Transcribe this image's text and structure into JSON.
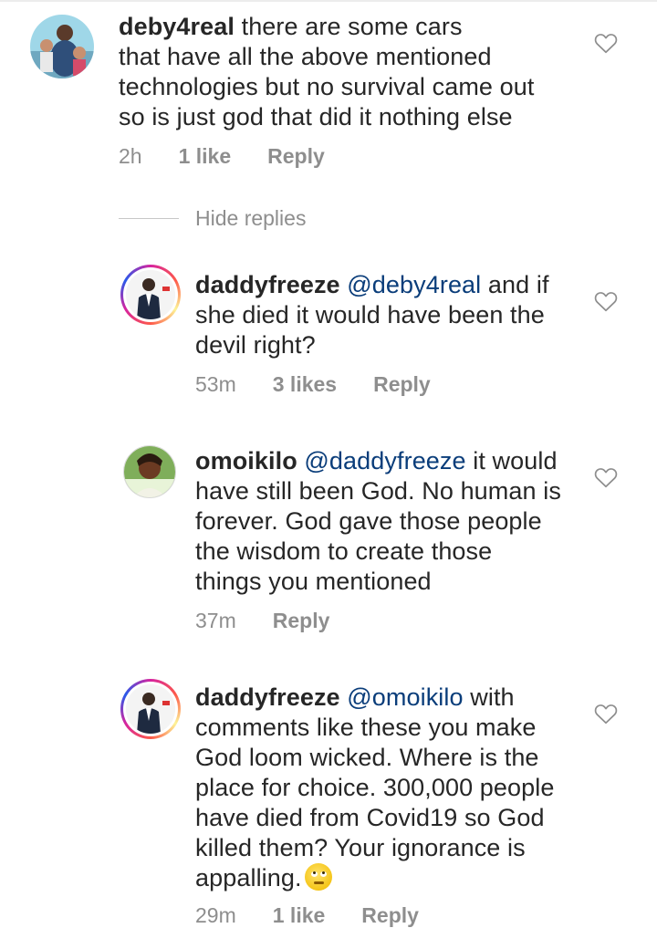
{
  "comments": [
    {
      "username": "deby4real",
      "mention": "",
      "lines": [
        "there are some cars",
        "that have all the above mentioned",
        "technologies but no survival came out",
        "so is just god that did it nothing else"
      ],
      "time": "2h",
      "likes": "1 like",
      "reply": "Reply"
    },
    {
      "username": "daddyfreeze",
      "mention": "@deby4real",
      "lines": [
        "and if",
        "she died it would have been the",
        "devil right?"
      ],
      "time": "53m",
      "likes": "3 likes",
      "reply": "Reply"
    },
    {
      "username": "omoikilo",
      "mention": "@daddyfreeze",
      "lines": [
        "it would",
        "have still been God. No human is",
        "forever. God gave those people",
        "the wisdom to create those",
        "things you mentioned"
      ],
      "time": "37m",
      "likes": "",
      "reply": "Reply"
    },
    {
      "username": "daddyfreeze",
      "mention": "@omoikilo",
      "lines": [
        "with",
        "comments like these you make",
        "God loom wicked. Where is the",
        "place for choice. 300,000 people",
        "have died from Covid19 so God",
        "killed them? Your ignorance is",
        "appalling."
      ],
      "time": "29m",
      "likes": "1 like",
      "reply": "Reply"
    }
  ],
  "hide_replies": "Hide replies",
  "icons": {
    "like": "heart-outline-icon",
    "emoji": "face-with-rolling-eyes-emoji"
  },
  "colors": {
    "text": "#262626",
    "meta": "#8e8e8e",
    "mention": "#0a3d7a"
  }
}
